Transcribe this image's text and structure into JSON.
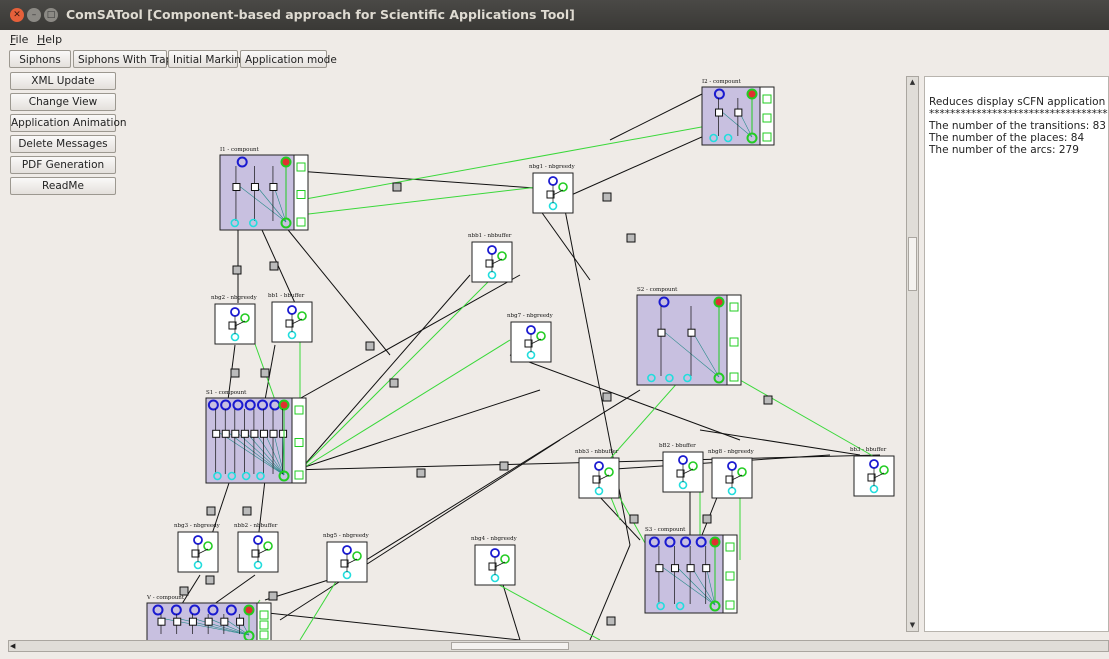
{
  "window": {
    "title": "ComSATool [Component-based approach for Scientific Applications Tool]"
  },
  "menu": {
    "items": [
      "File",
      "Help"
    ]
  },
  "toolbar": {
    "buttons": [
      "Siphons",
      "Siphons With Traps",
      "Initial Marking",
      "Application mode"
    ]
  },
  "sidebar": {
    "buttons": [
      "XML Update",
      "Change View",
      "Application Animation",
      "Delete Messages",
      "PDF Generation",
      "ReadMe"
    ]
  },
  "info_panel": {
    "lines": [
      "Reduces display sCFN application graph",
      "**************************************",
      "The number of the transitions: 83",
      "The number of the places: 84",
      "The number of the arcs: 279"
    ]
  },
  "graph": {
    "nodes": [
      {
        "label": "I1 - compount"
      },
      {
        "label": "I2 - compount"
      },
      {
        "label": "nbg1 - nbgreedy"
      },
      {
        "label": "nbb1 - nbbuffer"
      },
      {
        "label": "nbg2 - nbgreedy"
      },
      {
        "label": "bb1 - bbuffer"
      },
      {
        "label": "nbg7 - nbgreedy"
      },
      {
        "label": "S2 - compount"
      },
      {
        "label": "S1 - compount"
      },
      {
        "label": "nbb3 - nbbuffer"
      },
      {
        "label": "bB2 - bbuffer"
      },
      {
        "label": "nbg8 - nbgreedy"
      },
      {
        "label": "bb3 - bbuffer"
      },
      {
        "label": "nbg3 - nbgreedy"
      },
      {
        "label": "nbb2 - nbbuffer"
      },
      {
        "label": "nbg5 - nbgreedy"
      },
      {
        "label": "nbg4 - nbgreedy"
      },
      {
        "label": "S3 - compount"
      },
      {
        "label": "V - compount"
      }
    ]
  },
  "colors": {
    "compound_fill": "#c8c0e0",
    "place_blue": "#1a1ad0",
    "place_green": "#22cc22",
    "place_cyan": "#22dddd",
    "edge_green": "#3ad83a"
  }
}
